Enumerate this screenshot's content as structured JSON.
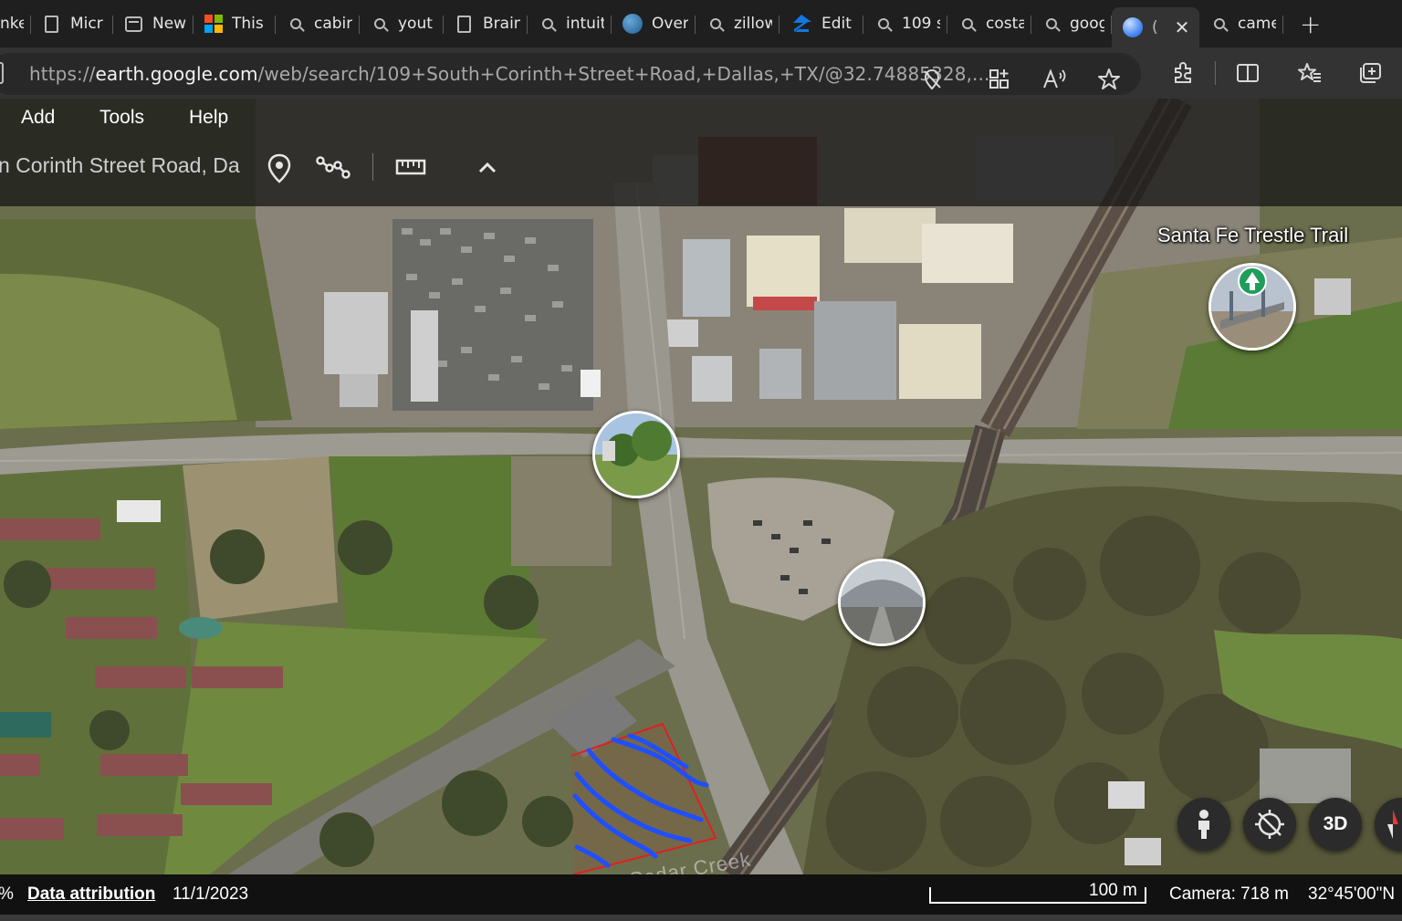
{
  "browser": {
    "tabs": [
      {
        "label": "nke",
        "favicon": "page-icon"
      },
      {
        "label": "Micr",
        "favicon": "document-icon"
      },
      {
        "label": "New",
        "favicon": "window-icon"
      },
      {
        "label": "This f",
        "favicon": "microsoft-icon"
      },
      {
        "label": "cabir",
        "favicon": "search-icon"
      },
      {
        "label": "yout",
        "favicon": "search-icon"
      },
      {
        "label": "Brain",
        "favicon": "document-icon"
      },
      {
        "label": "intuit",
        "favicon": "search-icon"
      },
      {
        "label": "Over",
        "favicon": "globe-icon"
      },
      {
        "label": "zillow",
        "favicon": "search-icon"
      },
      {
        "label": "Edit",
        "favicon": "zillow-icon"
      },
      {
        "label": "109 s",
        "favicon": "search-icon"
      },
      {
        "label": "costa",
        "favicon": "search-icon"
      },
      {
        "label": "goog",
        "favicon": "search-icon"
      },
      {
        "label": "(",
        "favicon": "earth-icon",
        "active": true
      },
      {
        "label": "came",
        "favicon": "search-icon"
      }
    ],
    "close_tab_glyph": "✕",
    "new_tab_glyph": "+",
    "url_prefix": "https://",
    "url_domain": "earth.google.com",
    "url_path": "/web/search/109+South+Corinth+Street+Road,+Dallas,+TX/@32.74885328,...",
    "toolbar_icons": [
      "tracking-prevention-icon",
      "app-available-icon",
      "read-aloud-icon",
      "favorite-star-icon",
      "extensions-icon",
      "split-screen-icon",
      "favorites-icon",
      "collections-icon"
    ]
  },
  "earth": {
    "menu": [
      "Add",
      "Tools",
      "Help"
    ],
    "search_text": "n Corinth Street Road, Da",
    "tools": [
      "location-pin-icon",
      "path-icon",
      "measure-ruler-icon",
      "collapse-chevron-icon"
    ],
    "map_labels": {
      "trail": "Santa Fe Trestle Trail",
      "creek": "Cedar Creek"
    },
    "controls": {
      "pegman": "pegman-icon",
      "compass": "compass-off-icon",
      "view_3d": "3D"
    },
    "colors": {
      "drawing_line": "#1f4fff",
      "parcel_outline": "#e02020",
      "trail_pin": "#1e9e5a"
    }
  },
  "status": {
    "percent": "%",
    "attribution": "Data attribution",
    "date": "11/1/2023",
    "scale": "100 m",
    "camera": "Camera: 718 m",
    "coords": "32°45'00\"N"
  }
}
